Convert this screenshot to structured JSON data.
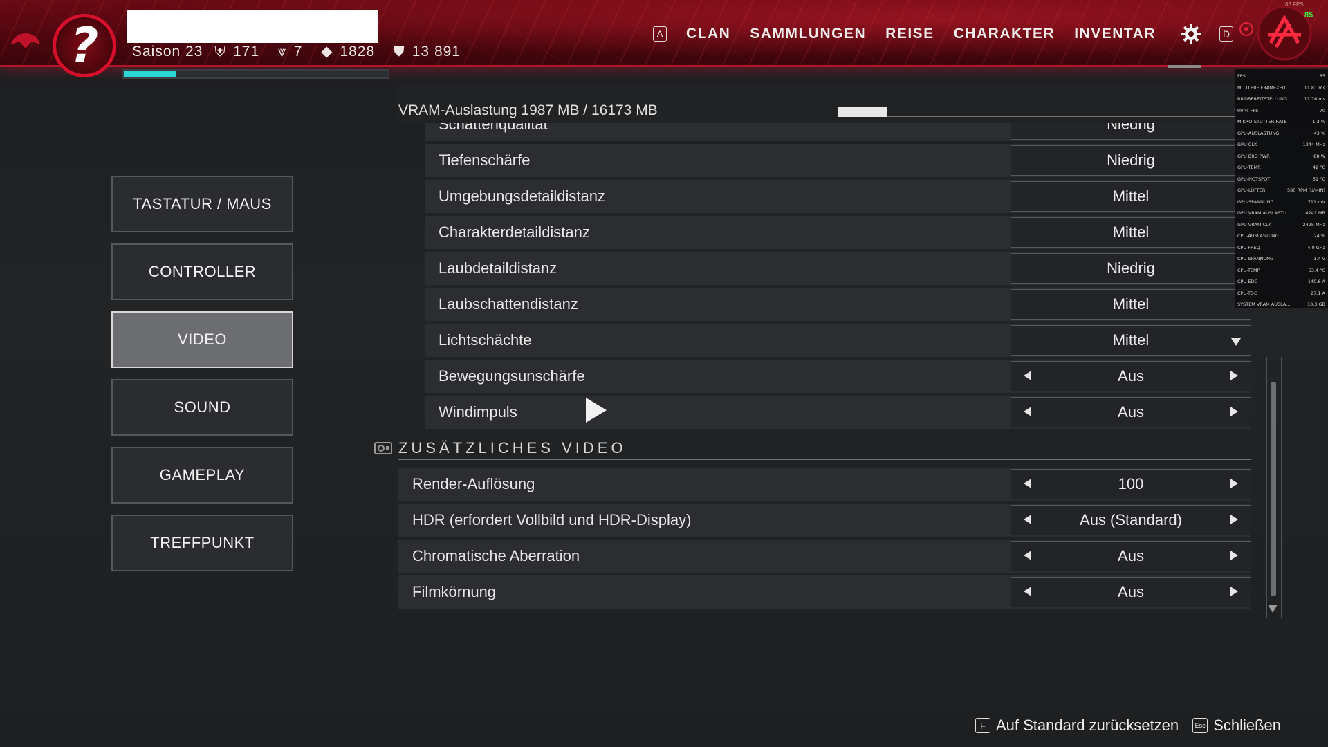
{
  "header": {
    "season": "Saison 23",
    "stat1": "171",
    "stat2": "7",
    "stat3": "1828",
    "stat4": "13 891",
    "season_progress": 0.2,
    "nav_key_left": "A",
    "nav_key_right": "D",
    "nav": [
      "CLAN",
      "SAMMLUNGEN",
      "REISE",
      "CHARAKTER",
      "INVENTAR"
    ],
    "fps_label": "85 FPS",
    "fps_value": "85"
  },
  "overlay": [
    [
      "FPS",
      "85"
    ],
    [
      "MITTLERE FRAMEZEIT",
      "11.81 ms"
    ],
    [
      "BILDBEREITSTELLUNG",
      "11.76 ms"
    ],
    [
      "99 % FPS",
      "70"
    ],
    [
      "MIKRO-STUTTER-RATE",
      "1.2 %"
    ],
    [
      "GPU-AUSLASTUNG",
      "43 %"
    ],
    [
      "GPU CLK",
      "1344 MHz"
    ],
    [
      "GPU BRD PWR",
      "88 W"
    ],
    [
      "GPU-TEMP.",
      "42 °C"
    ],
    [
      "GPU-HOTSPOT",
      "51 °C"
    ],
    [
      "GPU-LÜFTER",
      "580 RPM (U/MIN)"
    ],
    [
      "GPU-SPANNUNG",
      "711 mV"
    ],
    [
      "GPU VRAM AUSLASTU...",
      "4241 MB"
    ],
    [
      "GPU VRAM CLK",
      "2425 MHz"
    ],
    [
      "CPU-AUSLASTUNG",
      "24 %"
    ],
    [
      "CPU FREQ",
      "4.0 GHz"
    ],
    [
      "CPU-SPANNUNG",
      "1.4 V"
    ],
    [
      "CPU-TEMP",
      "53.4 °C"
    ],
    [
      "CPU-EDC",
      "140.6 A"
    ],
    [
      "CPU-TDC",
      "27.1 A"
    ],
    [
      "SYSTEM VRAM AUSLA...",
      "10.3 GB"
    ]
  ],
  "menu": {
    "items": [
      "TASTATUR / MAUS",
      "CONTROLLER",
      "VIDEO",
      "SOUND",
      "GAMEPLAY",
      "TREFFPUNKT"
    ],
    "active": "VIDEO"
  },
  "vram": {
    "label": "VRAM-Auslastung 1987 MB / 16173 MB",
    "used_fraction": 0.123
  },
  "settings": [
    {
      "label": "Schattenqualität",
      "value": "Niedrig",
      "control": "dropdown"
    },
    {
      "label": "Tiefenschärfe",
      "value": "Niedrig",
      "control": "dropdown"
    },
    {
      "label": "Umgebungsdetaildistanz",
      "value": "Mittel",
      "control": "dropdown"
    },
    {
      "label": "Charakterdetaildistanz",
      "value": "Mittel",
      "control": "dropdown"
    },
    {
      "label": "Laubdetaildistanz",
      "value": "Niedrig",
      "control": "dropdown"
    },
    {
      "label": "Laubschattendistanz",
      "value": "Mittel",
      "control": "dropdown"
    },
    {
      "label": "Lichtschächte",
      "value": "Mittel",
      "control": "dropdown"
    },
    {
      "label": "Bewegungsunschärfe",
      "value": "Aus",
      "control": "stepper"
    },
    {
      "label": "Windimpuls",
      "value": "Aus",
      "control": "stepper"
    }
  ],
  "additional": {
    "title": "ZUSÄTZLICHES VIDEO",
    "settings": [
      {
        "label": "Render-Auflösung",
        "value": "100",
        "control": "stepper"
      },
      {
        "label": "HDR (erfordert Vollbild und HDR-Display)",
        "value": "Aus (Standard)",
        "control": "stepper"
      },
      {
        "label": "Chromatische Aberration",
        "value": "Aus",
        "control": "stepper"
      },
      {
        "label": "Filmkörnung",
        "value": "Aus",
        "control": "stepper"
      }
    ]
  },
  "footer": {
    "reset_key": "F",
    "reset_label": "Auf Standard zurücksetzen",
    "close_key": "Esc",
    "close_label": "Schließen"
  },
  "colors": {
    "accent_red": "#b0152a",
    "progress_cyan": "#2dd6d6",
    "fps_green": "#3cf23c"
  }
}
